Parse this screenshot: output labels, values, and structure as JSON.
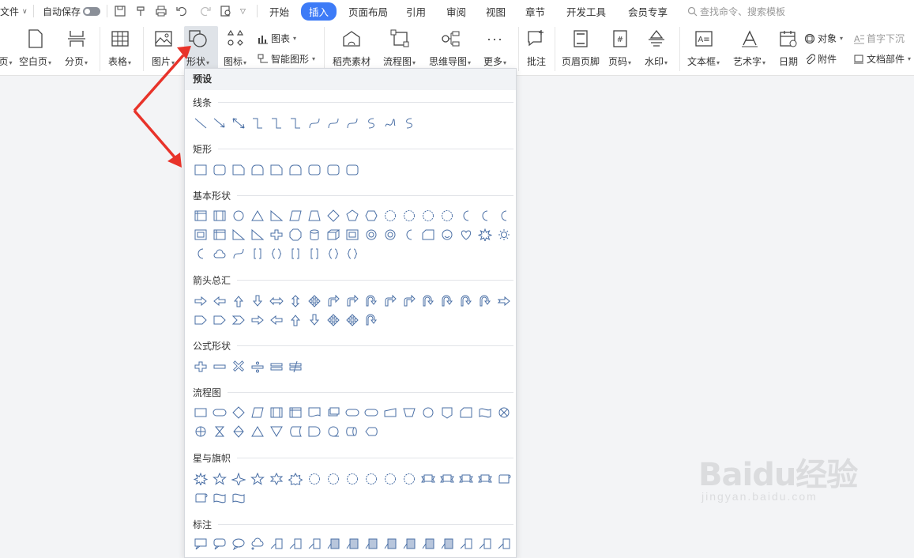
{
  "topbar": {
    "file_label": "文件",
    "autosave_label": "自动保存",
    "tabs": [
      {
        "label": "开始"
      },
      {
        "label": "插入"
      },
      {
        "label": "页面布局"
      },
      {
        "label": "引用"
      },
      {
        "label": "审阅"
      },
      {
        "label": "视图"
      },
      {
        "label": "章节"
      },
      {
        "label": "开发工具"
      },
      {
        "label": "会员专享"
      }
    ],
    "search_placeholder": "查找命令、搜索模板"
  },
  "ribbon": {
    "page_label": "页",
    "blank_page": "空白页",
    "page_break": "分页",
    "table": "表格",
    "picture": "图片",
    "shapes": "形状",
    "icons": "图标",
    "chart": "图表",
    "smart_art": "智能图形",
    "daoke": "稻壳素材",
    "flowchart": "流程图",
    "mindmap": "思维导图",
    "more": "更多",
    "comment": "批注",
    "header_footer": "页眉页脚",
    "page_number": "页码",
    "watermark": "水印",
    "textbox": "文本框",
    "wordart": "艺术字",
    "date": "日期",
    "object": "对象",
    "attachment": "附件",
    "dropcap": "首字下沉",
    "doc_parts": "文档部件"
  },
  "panel": {
    "title": "预设",
    "categories": [
      {
        "label": "线条"
      },
      {
        "label": "矩形"
      },
      {
        "label": "基本形状"
      },
      {
        "label": "箭头总汇"
      },
      {
        "label": "公式形状"
      },
      {
        "label": "流程图"
      },
      {
        "label": "星与旗帜"
      },
      {
        "label": "标注"
      }
    ]
  },
  "watermark": {
    "main": "Baidu经验",
    "sub": "jingyan.baidu.com"
  },
  "colors": {
    "accent": "#3d7bf7",
    "shape_stroke": "#4a6fa5",
    "annotation": "#e8332a"
  }
}
